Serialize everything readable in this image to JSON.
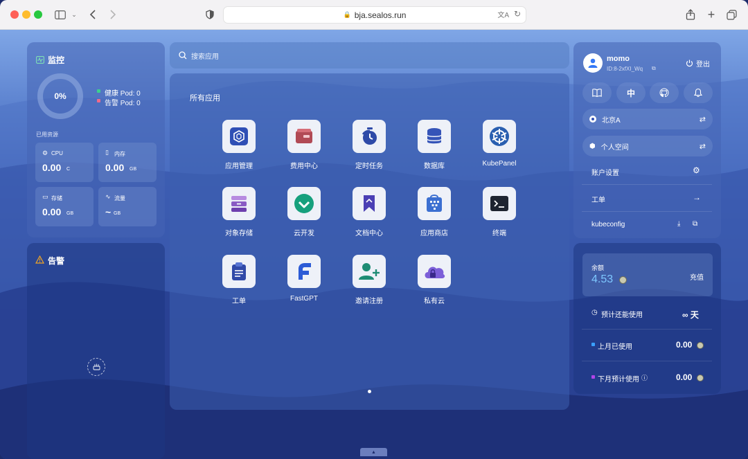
{
  "browser": {
    "url": "bja.sealos.run"
  },
  "monitor": {
    "title": "监控",
    "percent": "0%",
    "healthy_label": "健康 Pod: 0",
    "alert_label": "告警 Pod: 0",
    "used_resources": "已用资源",
    "cards": [
      {
        "label": "CPU",
        "value": "0.00",
        "unit": "C"
      },
      {
        "label": "内存",
        "value": "0.00",
        "unit": "GB"
      },
      {
        "label": "存储",
        "value": "0.00",
        "unit": "GB"
      },
      {
        "label": "流量",
        "value": "~",
        "unit": "GB"
      }
    ]
  },
  "alerts": {
    "title": "告警"
  },
  "search": {
    "placeholder": "搜索应用"
  },
  "apps": {
    "title": "所有应用",
    "items": [
      {
        "label": "应用管理",
        "icon": "app-manage-icon"
      },
      {
        "label": "费用中心",
        "icon": "wallet-icon"
      },
      {
        "label": "定时任务",
        "icon": "timer-icon"
      },
      {
        "label": "数据库",
        "icon": "database-icon"
      },
      {
        "label": "KubePanel",
        "icon": "kubernetes-icon"
      },
      {
        "label": "对象存储",
        "icon": "object-storage-icon"
      },
      {
        "label": "云开发",
        "icon": "cloud-dev-icon"
      },
      {
        "label": "文档中心",
        "icon": "docs-icon"
      },
      {
        "label": "应用商店",
        "icon": "app-store-icon"
      },
      {
        "label": "终端",
        "icon": "terminal-icon"
      },
      {
        "label": "工单",
        "icon": "clipboard-icon"
      },
      {
        "label": "FastGPT",
        "icon": "fastgpt-icon"
      },
      {
        "label": "邀请注册",
        "icon": "invite-user-icon"
      },
      {
        "label": "私有云",
        "icon": "private-cloud-icon"
      }
    ]
  },
  "user": {
    "name": "momo",
    "id": "ID:8-2xfXI_Wq",
    "logout": "登出",
    "lang": "中",
    "region": "北京A",
    "workspace": "个人空间",
    "account_settings": "账户设置",
    "ticket": "工单",
    "kubeconfig": "kubeconfig"
  },
  "billing": {
    "balance_label": "余额",
    "balance": "4.53",
    "recharge": "充值",
    "estimate_label": "预计还能使用",
    "estimate_value": "∞ 天",
    "last_month_label": "上月已使用",
    "last_month_value": "0.00",
    "next_month_label": "下月预计使用",
    "next_month_value": "0.00"
  },
  "colors": {
    "healthy": "#3ecf8e",
    "alert": "#f06a8a",
    "balance": "#7ec8ff"
  }
}
